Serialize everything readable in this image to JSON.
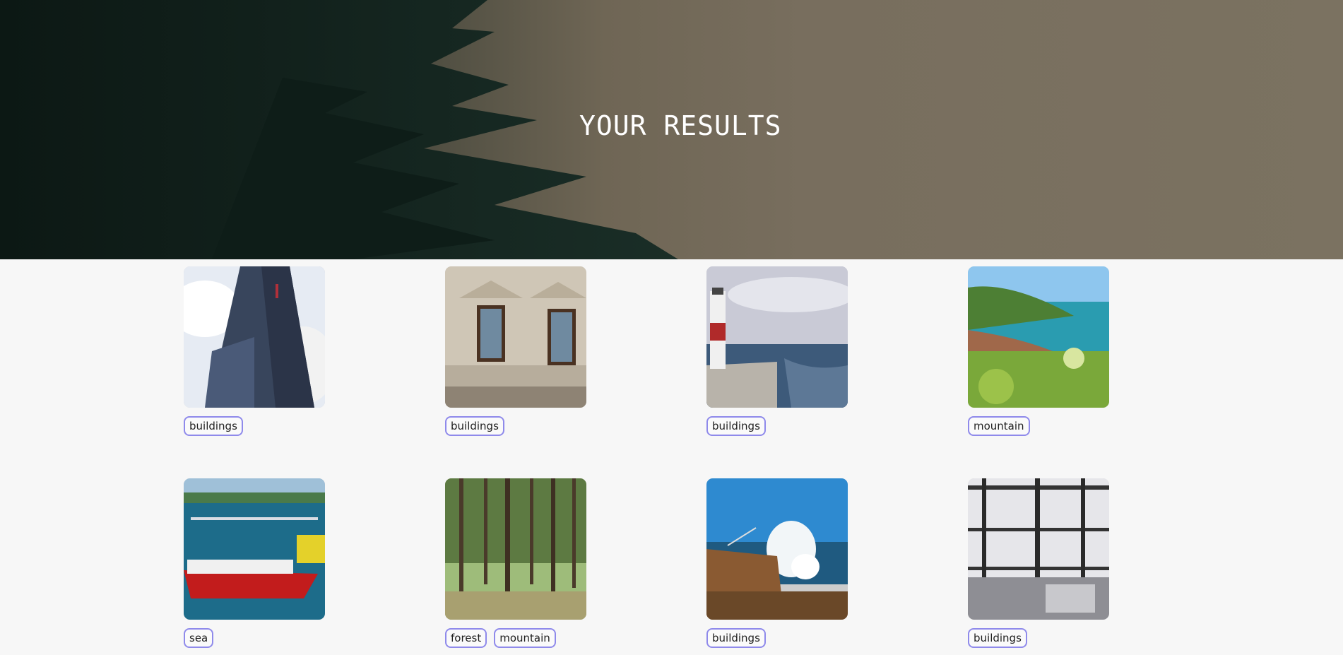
{
  "hero": {
    "title": "YOUR RESULTS"
  },
  "results": [
    {
      "image": "skyscraper-photo",
      "tags": [
        "buildings"
      ]
    },
    {
      "image": "building-facade-photo",
      "tags": [
        "buildings"
      ]
    },
    {
      "image": "lighthouse-photo",
      "tags": [
        "buildings"
      ]
    },
    {
      "image": "coastal-cove-photo",
      "tags": [
        "mountain"
      ]
    },
    {
      "image": "harbor-boat-photo",
      "tags": [
        "sea"
      ]
    },
    {
      "image": "pine-forest-photo",
      "tags": [
        "forest",
        "mountain"
      ]
    },
    {
      "image": "crashing-wave-photo",
      "tags": [
        "buildings"
      ]
    },
    {
      "image": "steel-frame-construction-photo",
      "tags": [
        "buildings"
      ]
    }
  ],
  "colors": {
    "tag_border": "#8f8aeb",
    "background": "#f7f7f7"
  }
}
